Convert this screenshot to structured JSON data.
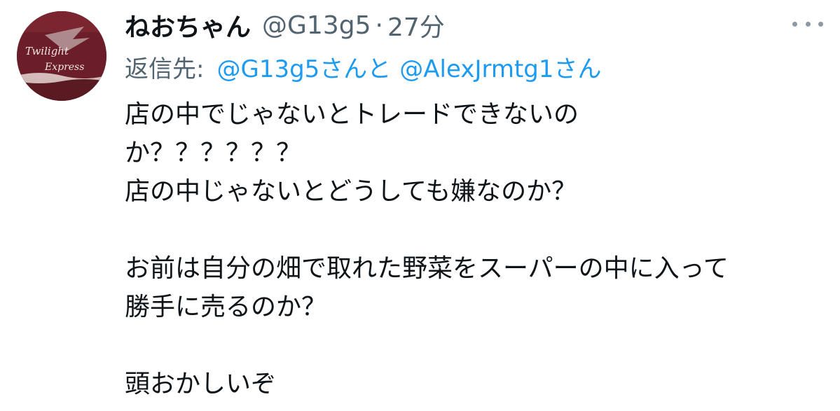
{
  "tweet": {
    "display_name": "ねおちゃん",
    "handle": "@G13g5",
    "separator": "·",
    "time": "27分",
    "reply": {
      "prefix": "返信先:",
      "mention_1": "@G13g5さんと",
      "mention_2": "@AlexJrmtg1さん"
    },
    "body_lines": [
      "店の中でじゃないとトレードできないの",
      "か？？？？？？",
      "店の中じゃないとどうしても嫌なのか？",
      "",
      "お前は自分の畑で取れた野菜をスーパーの中に入って",
      "勝手に売るのか？",
      "",
      "頭おかしいぞ"
    ]
  },
  "avatar": {
    "text_line_1": "Twilight",
    "text_line_2": "Express"
  },
  "icons": {
    "more": "more-horizontal-icon"
  },
  "colors": {
    "text": "#0f1419",
    "secondary": "#536471",
    "link": "#1d9bf0",
    "avatar_bg": "#6a1f2a"
  }
}
